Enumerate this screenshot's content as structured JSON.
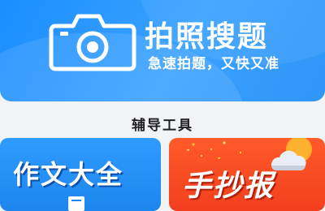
{
  "banner": {
    "title": "拍照搜题",
    "subtitle": "急速拍题，又快又准",
    "icon": "camera-icon"
  },
  "section": {
    "title": "辅导工具"
  },
  "cards": [
    {
      "label": "作文大全",
      "icon": "book-icon",
      "color": "#1c86ee"
    },
    {
      "label": "手抄报",
      "icon": "weather-icon",
      "color": "#f23f1e"
    }
  ]
}
